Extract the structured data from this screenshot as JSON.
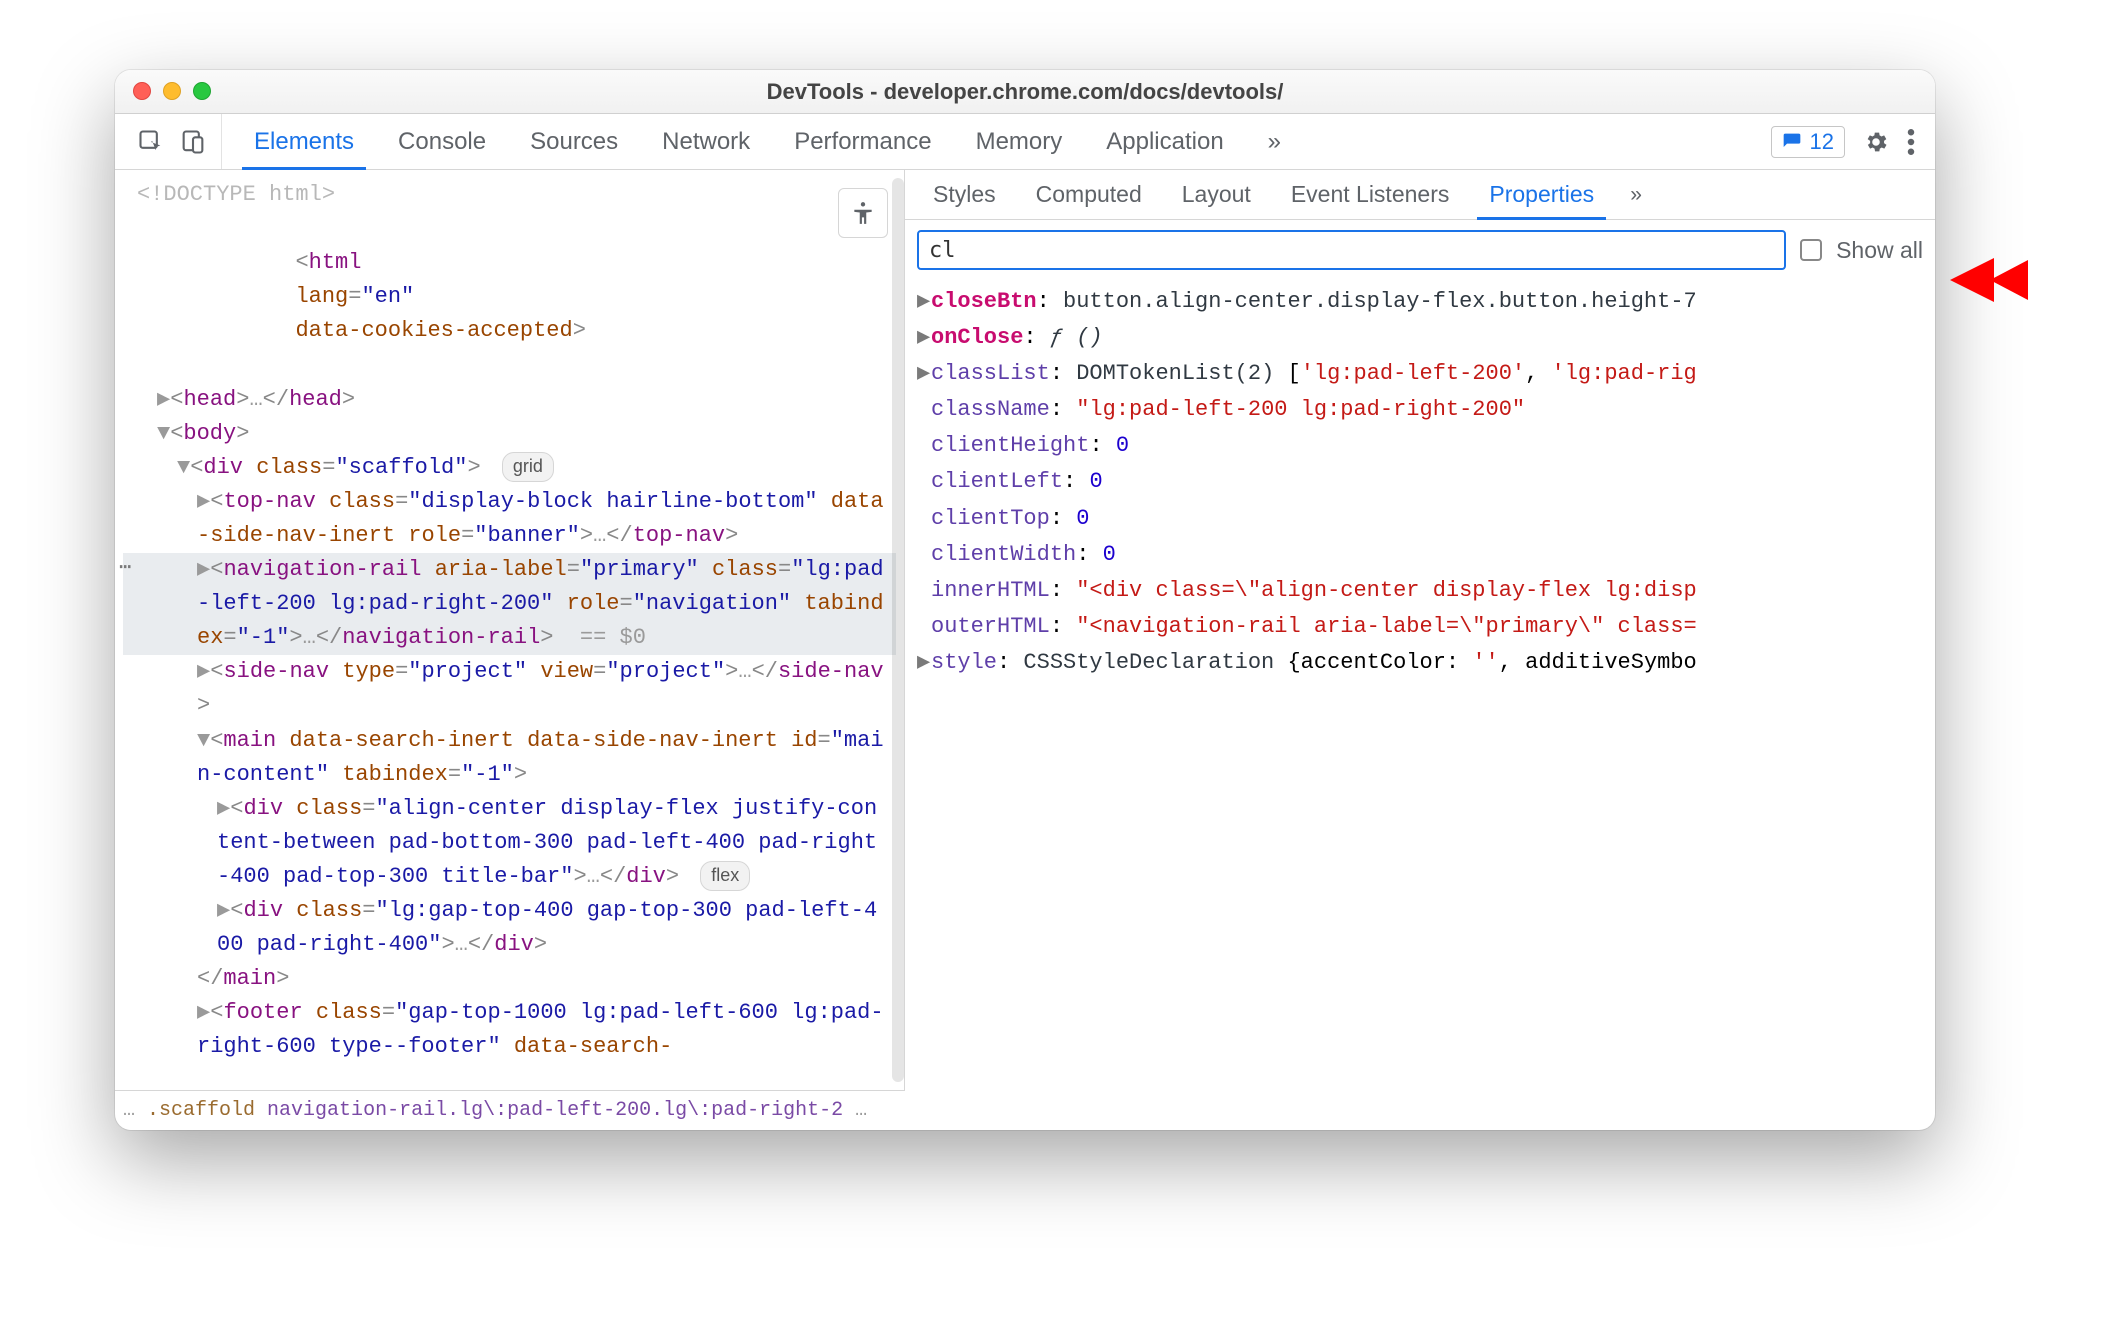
{
  "window": {
    "title": "DevTools - developer.chrome.com/docs/devtools/"
  },
  "mainTabs": {
    "elements": "Elements",
    "console": "Console",
    "sources": "Sources",
    "network": "Network",
    "performance": "Performance",
    "memory": "Memory",
    "application": "Application",
    "more": "»"
  },
  "issues": {
    "count": "12"
  },
  "dom": {
    "doctype": "<!DOCTYPE html>",
    "htmlOpen_pre": "<",
    "htmlOpen_tag": "html",
    "htmlOpen_a1n": "lang",
    "htmlOpen_a1v": "\"en\"",
    "htmlOpen_a2n": "data-cookies-accepted",
    "htmlOpen_post": ">",
    "head": "▶<head>…</head>",
    "bodyOpen": "▼<body>",
    "div_scaffold_pre": "▼<",
    "div_scaffold_tag": "div",
    "div_scaffold_a1n": "class",
    "div_scaffold_a1v": "\"scaffold\"",
    "div_scaffold_post": ">",
    "badge_grid": "grid",
    "topnav": "▶<top-nav class=\"display-block hairline-bottom\" data-side-nav-inert role=\"banner\">…</top-nav>",
    "navrail": "▶<navigation-rail aria-label=\"primary\" class=\"lg:pad-left-200 lg:pad-right-200\" role=\"navigation\" tabindex=\"-1\">…</navigation-rail> == $0",
    "sidenav": "▶<side-nav type=\"project\" view=\"project\">…</side-nav>",
    "main_open": "▼<main data-search-inert data-side-nav-inert id=\"main-content\" tabindex=\"-1\">",
    "main_div1": "▶<div class=\"align-center display-flex justify-content-between pad-bottom-300 pad-left-400 pad-right-400 pad-top-300 title-bar\">…</div>",
    "badge_flex": "flex",
    "main_div2": "▶<div class=\"lg:gap-top-400 gap-top-300 pad-left-400 pad-right-400\">…</div>",
    "main_close": "</main>",
    "footer": "▶<footer class=\"gap-top-1000 lg:pad-left-600 lg:pad-right-600 type--footer\" data-search-"
  },
  "breadcrumb": {
    "pre": "…",
    "a": ".scaffold",
    "b": "navigation-rail.lg\\:pad-left-200.lg\\:pad-right-2",
    "post": "…"
  },
  "sideTabs": {
    "styles": "Styles",
    "computed": "Computed",
    "layout": "Layout",
    "eventlisteners": "Event Listeners",
    "properties": "Properties",
    "more": "»"
  },
  "filter": {
    "value": "cl",
    "showAll": "Show all"
  },
  "props": [
    {
      "tri": "▶",
      "keyClass": "key-own",
      "key": "closeBtn",
      "sep": ": ",
      "valHtml": "<span class='val-name'>button.align-center.display-flex.button.height-7</span>"
    },
    {
      "tri": "▶",
      "keyClass": "key-own",
      "key": "onClose",
      "sep": ": ",
      "valHtml": "<span class='val-func'>ƒ ()</span>"
    },
    {
      "tri": "▶",
      "keyClass": "key-inh",
      "key": "classList",
      "sep": ": ",
      "valHtml": "<span class='val-name'>DOMTokenList(2)</span> [<span class='val-str'>'lg:pad-left-200'</span>, <span class='val-str'>'lg:pad-rig</span>"
    },
    {
      "tri": "",
      "keyClass": "key-inh",
      "key": "className",
      "sep": ": ",
      "valHtml": "<span class='val-str'>\"lg:pad-left-200 lg:pad-right-200\"</span>"
    },
    {
      "tri": "",
      "keyClass": "key-inh",
      "key": "clientHeight",
      "sep": ": ",
      "valHtml": "<span class='val-num'>0</span>"
    },
    {
      "tri": "",
      "keyClass": "key-inh",
      "key": "clientLeft",
      "sep": ": ",
      "valHtml": "<span class='val-num'>0</span>"
    },
    {
      "tri": "",
      "keyClass": "key-inh",
      "key": "clientTop",
      "sep": ": ",
      "valHtml": "<span class='val-num'>0</span>"
    },
    {
      "tri": "",
      "keyClass": "key-inh",
      "key": "clientWidth",
      "sep": ": ",
      "valHtml": "<span class='val-num'>0</span>"
    },
    {
      "tri": "",
      "keyClass": "key-inh",
      "key": "innerHTML",
      "sep": ": ",
      "valHtml": "<span class='val-str'>\"&lt;div class=\\\"align-center display-flex lg:disp</span>"
    },
    {
      "tri": "",
      "keyClass": "key-inh",
      "key": "outerHTML",
      "sep": ": ",
      "valHtml": "<span class='val-str'>\"&lt;navigation-rail aria-label=\\\"primary\\\" class=</span>"
    },
    {
      "tri": "▶",
      "keyClass": "key-inh",
      "key": "style",
      "sep": ": ",
      "valHtml": "<span class='val-name'>CSSStyleDeclaration</span> {accentColor: <span class='val-str'>''</span>, additiveSymbo"
    }
  ]
}
